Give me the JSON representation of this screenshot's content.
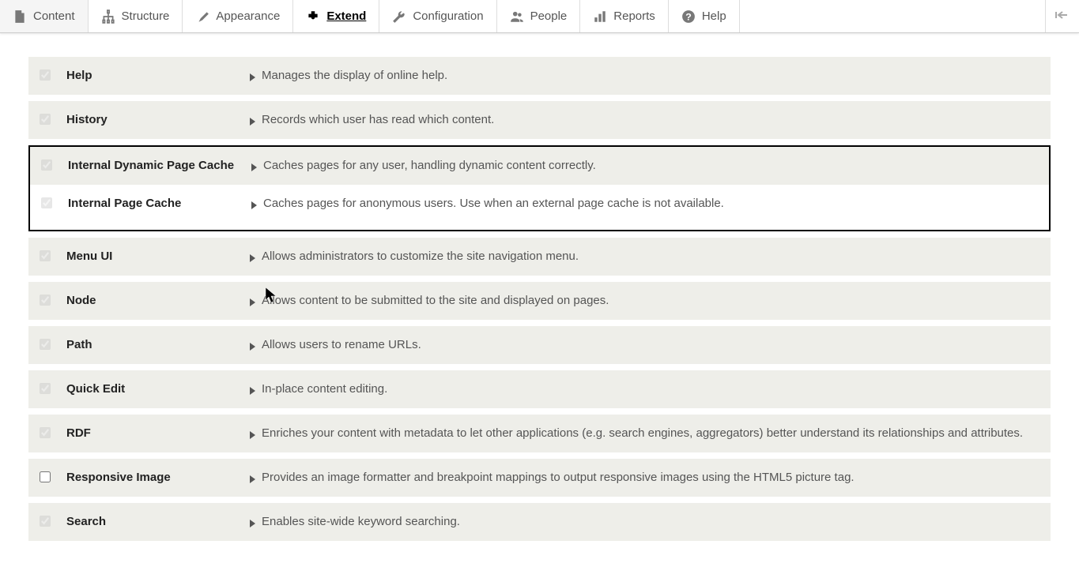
{
  "toolbar": {
    "items": [
      {
        "label": "Content",
        "icon": "content",
        "active": false
      },
      {
        "label": "Structure",
        "icon": "structure",
        "active": false
      },
      {
        "label": "Appearance",
        "icon": "appearance",
        "active": false
      },
      {
        "label": "Extend",
        "icon": "extend",
        "active": true
      },
      {
        "label": "Configuration",
        "icon": "configuration",
        "active": false
      },
      {
        "label": "People",
        "icon": "people",
        "active": false
      },
      {
        "label": "Reports",
        "icon": "reports",
        "active": false
      },
      {
        "label": "Help",
        "icon": "help",
        "active": false
      }
    ]
  },
  "modules": [
    {
      "name": "Help",
      "description": "Manages the display of online help.",
      "checked": true,
      "locked": true,
      "highlight": false
    },
    {
      "name": "History",
      "description": "Records which user has read which content.",
      "checked": true,
      "locked": true,
      "highlight": false
    },
    {
      "name": "Internal Dynamic Page Cache",
      "description": "Caches pages for any user, handling dynamic content correctly.",
      "checked": true,
      "locked": true,
      "highlight": true
    },
    {
      "name": "Internal Page Cache",
      "description": "Caches pages for anonymous users. Use when an external page cache is not available.",
      "checked": true,
      "locked": true,
      "highlight": true
    },
    {
      "name": "Menu UI",
      "description": "Allows administrators to customize the site navigation menu.",
      "checked": true,
      "locked": true,
      "highlight": false
    },
    {
      "name": "Node",
      "description": "Allows content to be submitted to the site and displayed on pages.",
      "checked": true,
      "locked": true,
      "highlight": false
    },
    {
      "name": "Path",
      "description": "Allows users to rename URLs.",
      "checked": true,
      "locked": true,
      "highlight": false
    },
    {
      "name": "Quick Edit",
      "description": "In-place content editing.",
      "checked": true,
      "locked": true,
      "highlight": false
    },
    {
      "name": "RDF",
      "description": "Enriches your content with metadata to let other applications (e.g. search engines, aggregators) better understand its relationships and attributes.",
      "checked": true,
      "locked": true,
      "highlight": false
    },
    {
      "name": "Responsive Image",
      "description": "Provides an image formatter and breakpoint mappings to output responsive images using the HTML5 picture tag.",
      "checked": false,
      "locked": false,
      "highlight": false
    },
    {
      "name": "Search",
      "description": "Enables site-wide keyword searching.",
      "checked": true,
      "locked": true,
      "highlight": false
    }
  ]
}
